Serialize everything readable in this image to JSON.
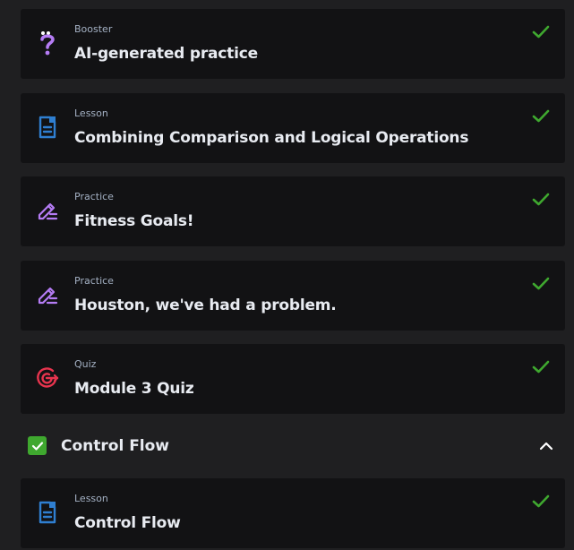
{
  "items": [
    {
      "type": "Booster",
      "title": "AI-generated practice",
      "icon": "booster-question-icon",
      "completed": true
    },
    {
      "type": "Lesson",
      "title": "Combining Comparison and Logical Operations",
      "icon": "lesson-document-icon",
      "completed": true
    },
    {
      "type": "Practice",
      "title": "Fitness Goals!",
      "icon": "practice-pencil-icon",
      "completed": true
    },
    {
      "type": "Practice",
      "title": "Houston, we've had a problem.",
      "icon": "practice-pencil-icon",
      "completed": true
    },
    {
      "type": "Quiz",
      "title": "Module 3 Quiz",
      "icon": "quiz-target-icon",
      "completed": true
    }
  ],
  "section": {
    "label": "Control Flow",
    "completed": true,
    "expanded": true
  },
  "section_items": [
    {
      "type": "Lesson",
      "title": "Control Flow",
      "icon": "lesson-document-icon",
      "completed": true
    }
  ],
  "colors": {
    "background": "#1f1f21",
    "card": "#121214",
    "check_green": "#3fa82f",
    "booster_purple": "#b57cf5",
    "lesson_blue": "#2f7fd1",
    "practice_purple": "#b57cf5",
    "quiz_red": "#e8344e"
  }
}
